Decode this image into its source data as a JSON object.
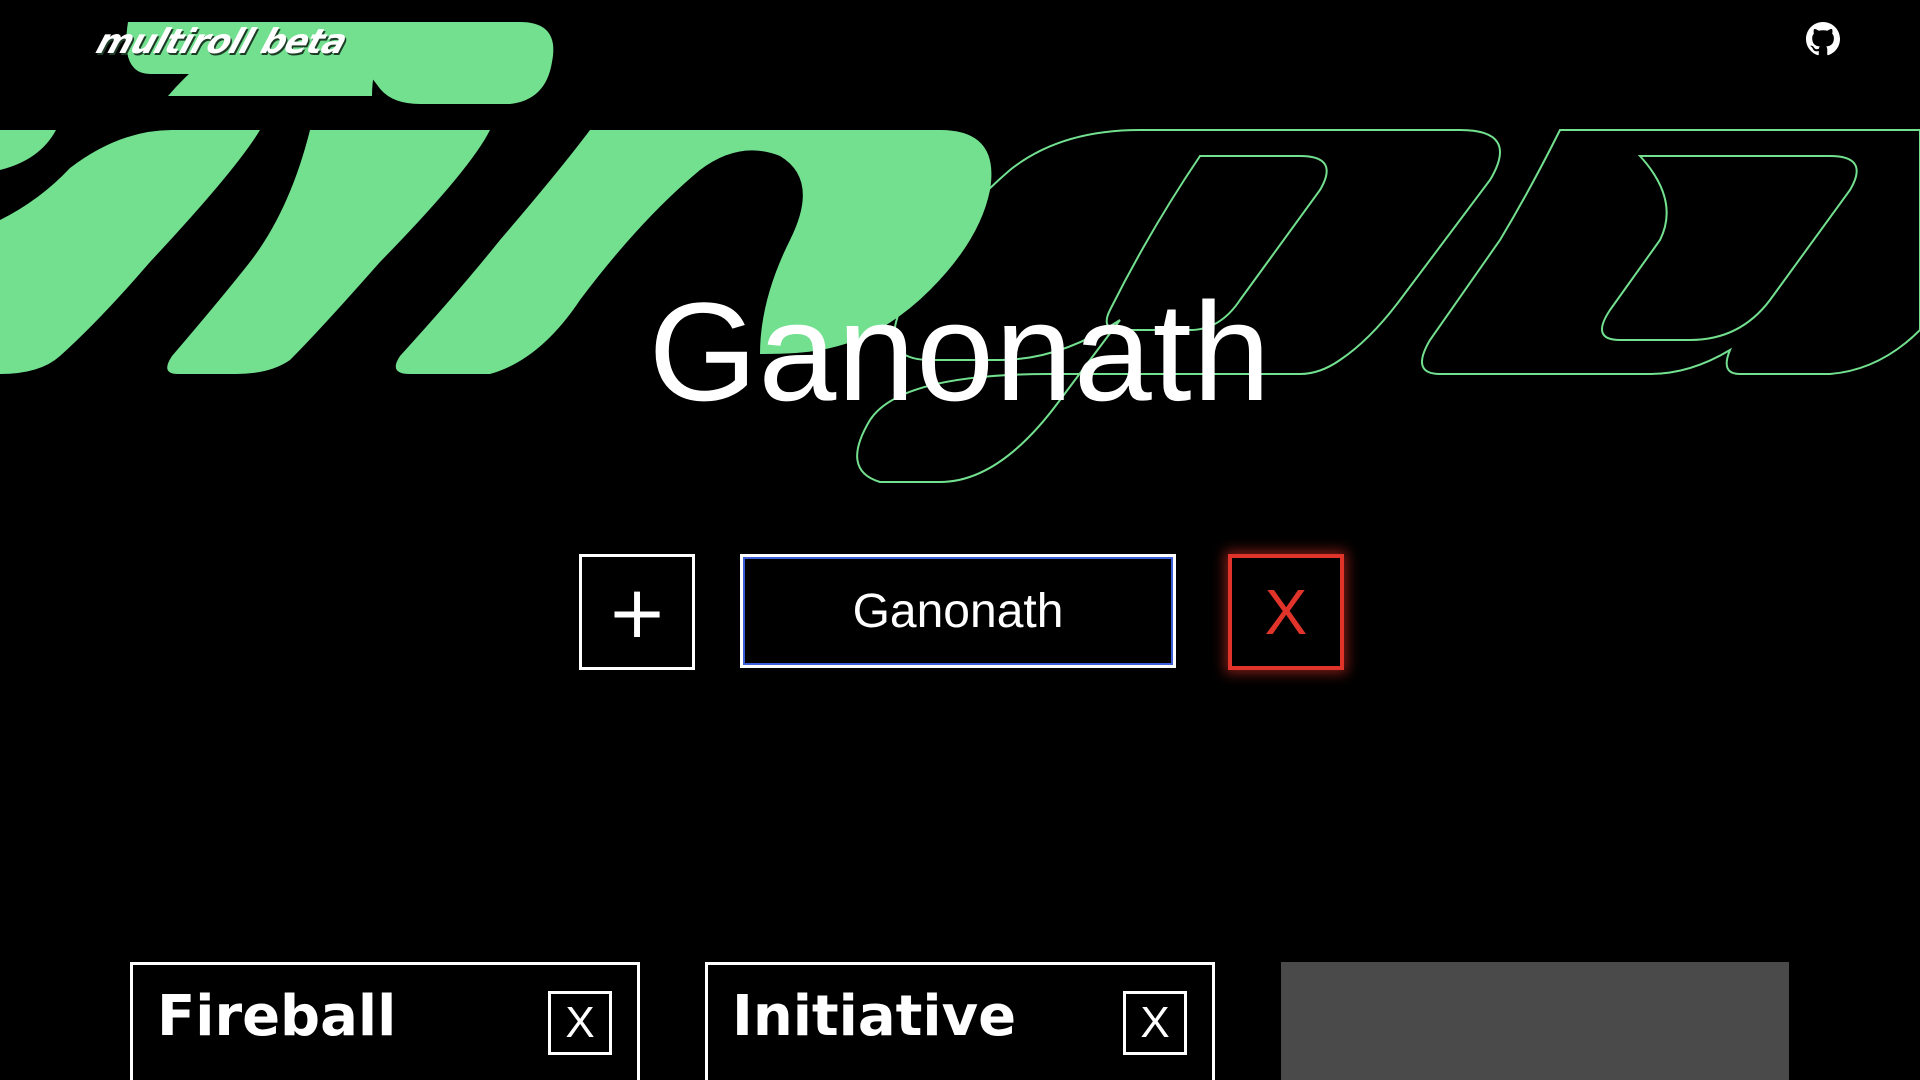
{
  "app": {
    "logo_text": "multiroll beta",
    "github_icon": "github-icon"
  },
  "background": {
    "accent_color": "#72e08f",
    "outline_color": "#72e08f"
  },
  "character": {
    "title": "Ganonath",
    "name_input_value": "Ganonath",
    "add_button_label": "+",
    "delete_button_label": "X",
    "delete_color": "#e0342a"
  },
  "rolls": {
    "items": [
      {
        "label": "Fireball",
        "remove_label": "X"
      },
      {
        "label": "Initiative",
        "remove_label": "X"
      }
    ]
  }
}
